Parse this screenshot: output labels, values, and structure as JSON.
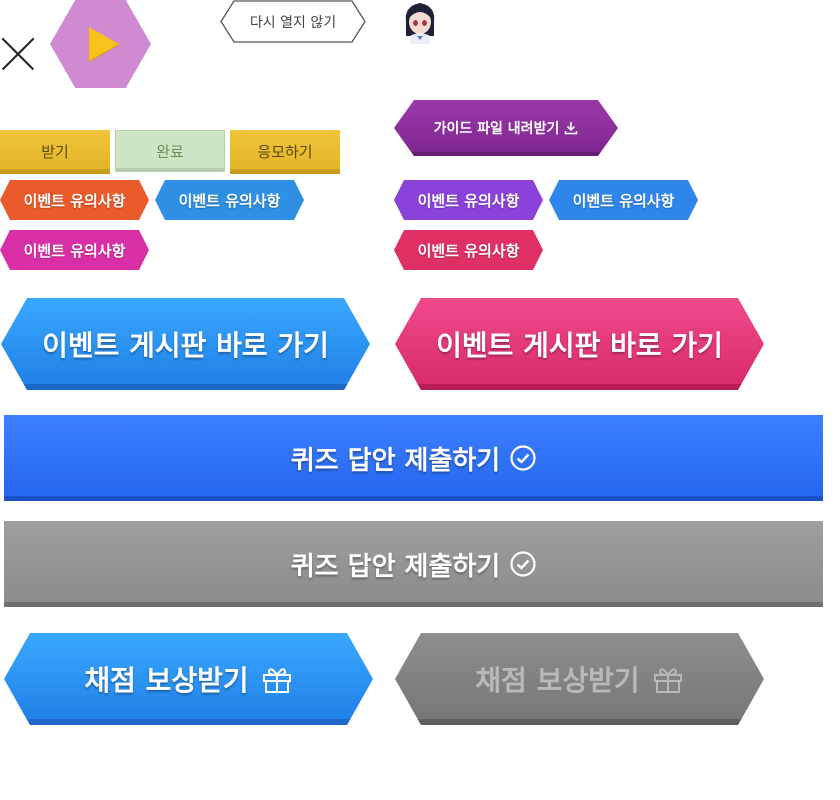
{
  "popup": {
    "no_reopen_label": "다시 열지 않기"
  },
  "small_buttons": {
    "receive": "받기",
    "done": "완료",
    "apply": "응모하기"
  },
  "guide_button": {
    "label": "가이드 파일 내려받기"
  },
  "event_notes": [
    {
      "label": "이벤트 유의사항",
      "color": "#ea5a2a"
    },
    {
      "label": "이벤트 유의사항",
      "color": "#2f8fe3"
    },
    {
      "label": "이벤트 유의사항",
      "color": "#d92fa6"
    },
    {
      "label": "이벤트 유의사항",
      "color": "#8a42db"
    },
    {
      "label": "이벤트 유의사항",
      "color": "#2f86ea"
    },
    {
      "label": "이벤트 유의사항",
      "color": "#df2f63"
    }
  ],
  "board_buttons": [
    {
      "label": "이벤트 게시판 바로 가기",
      "color": "blue"
    },
    {
      "label": "이벤트 게시판 바로 가기",
      "color": "pink"
    }
  ],
  "quiz_buttons": [
    {
      "label": "퀴즈 답안 제출하기",
      "state": "active"
    },
    {
      "label": "퀴즈 답안 제출하기",
      "state": "disabled"
    }
  ],
  "reward_buttons": [
    {
      "label": "채점 보상받기",
      "state": "active"
    },
    {
      "label": "채점 보상받기",
      "state": "disabled"
    }
  ],
  "icons": {
    "close": "close-icon",
    "play": "play-icon",
    "avatar": "avatar",
    "download": "download-icon",
    "check": "check-circle-icon",
    "gift": "gift-icon"
  }
}
